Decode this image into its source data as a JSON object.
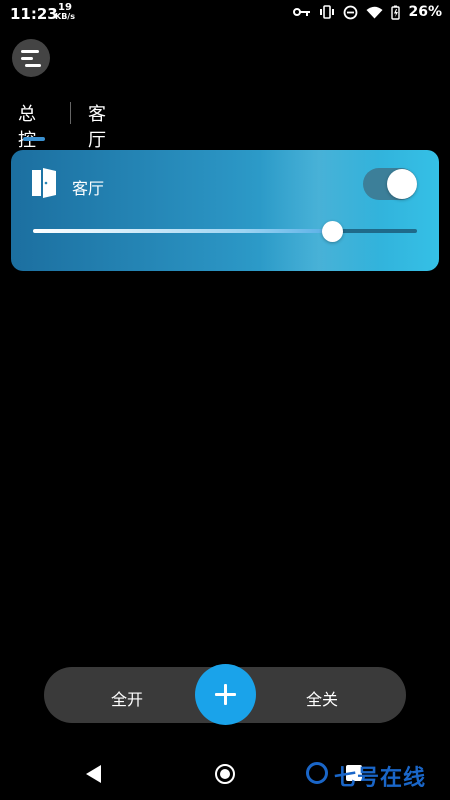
{
  "status_bar": {
    "time": "11:23",
    "net_speed_value": "19",
    "net_speed_unit": "KB/s",
    "battery_percent": "26%",
    "icons": [
      "key-icon",
      "vibrate-icon",
      "dnd-icon",
      "wifi-icon",
      "battery-icon"
    ]
  },
  "header": {
    "menu_icon": "menu-icon"
  },
  "tabs": [
    {
      "label": "总控",
      "active": true
    },
    {
      "label": "客厅",
      "active": false
    }
  ],
  "room_card": {
    "name": "客厅",
    "icon": "door-icon",
    "switch_on": true,
    "brightness_fraction": 0.78,
    "colors": {
      "gradient_start": "#1c6fa0",
      "gradient_end": "#35c0e6"
    }
  },
  "actions": {
    "all_on_label": "全开",
    "all_off_label": "全关",
    "add_icon": "plus-icon",
    "fab_color": "#1aa3ea"
  },
  "nav_bar": {
    "icons": [
      "back-icon",
      "home-icon",
      "recents-icon"
    ]
  },
  "watermark": {
    "text": "七号在线"
  }
}
